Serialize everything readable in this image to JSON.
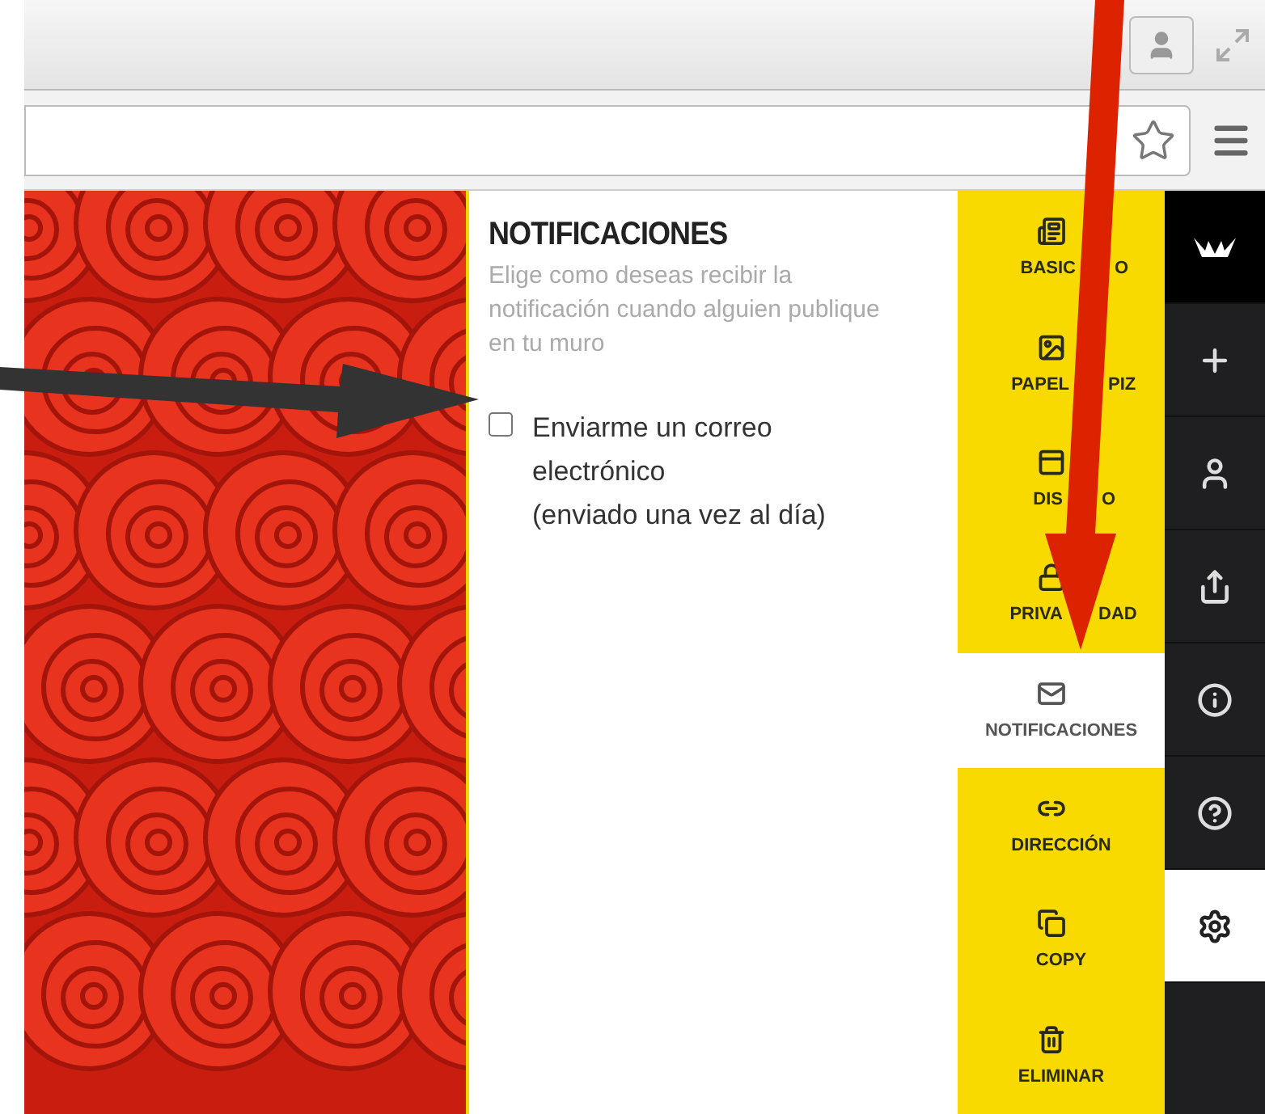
{
  "panel": {
    "title": "NOTIFICACIONES",
    "description": "Elige como deseas recibir la notificación cuando alguien publique en tu muro",
    "options": [
      {
        "label": "Enviarme un correo electrónico",
        "note": "(enviado una vez al día)",
        "checked": false
      }
    ]
  },
  "nav_items": [
    {
      "kind": "info",
      "label_parts": [
        "BASIC",
        "O"
      ],
      "selected": false
    },
    {
      "kind": "image",
      "label_parts": [
        "PAPEL",
        "PIZ"
      ],
      "selected": false
    },
    {
      "kind": "layout",
      "label_parts": [
        "DIS",
        "O"
      ],
      "selected": false
    },
    {
      "kind": "lock",
      "label_parts": [
        "PRIVA",
        "DAD"
      ],
      "selected": false
    },
    {
      "kind": "mail",
      "label_parts": [
        "NOTIFICACIONES"
      ],
      "selected": true
    },
    {
      "kind": "link",
      "label_parts": [
        "DIRECCIÓN"
      ],
      "selected": false
    },
    {
      "kind": "copy",
      "label_parts": [
        "COPY"
      ],
      "selected": false
    },
    {
      "kind": "trash",
      "label_parts": [
        "ELIMINAR"
      ],
      "selected": false
    }
  ],
  "side_icons": [
    {
      "kind": "logo",
      "selected": false
    },
    {
      "kind": "plus",
      "selected": false
    },
    {
      "kind": "user",
      "selected": false
    },
    {
      "kind": "share",
      "selected": false
    },
    {
      "kind": "info",
      "selected": false
    },
    {
      "kind": "help",
      "selected": false
    },
    {
      "kind": "settings",
      "selected": true
    }
  ]
}
